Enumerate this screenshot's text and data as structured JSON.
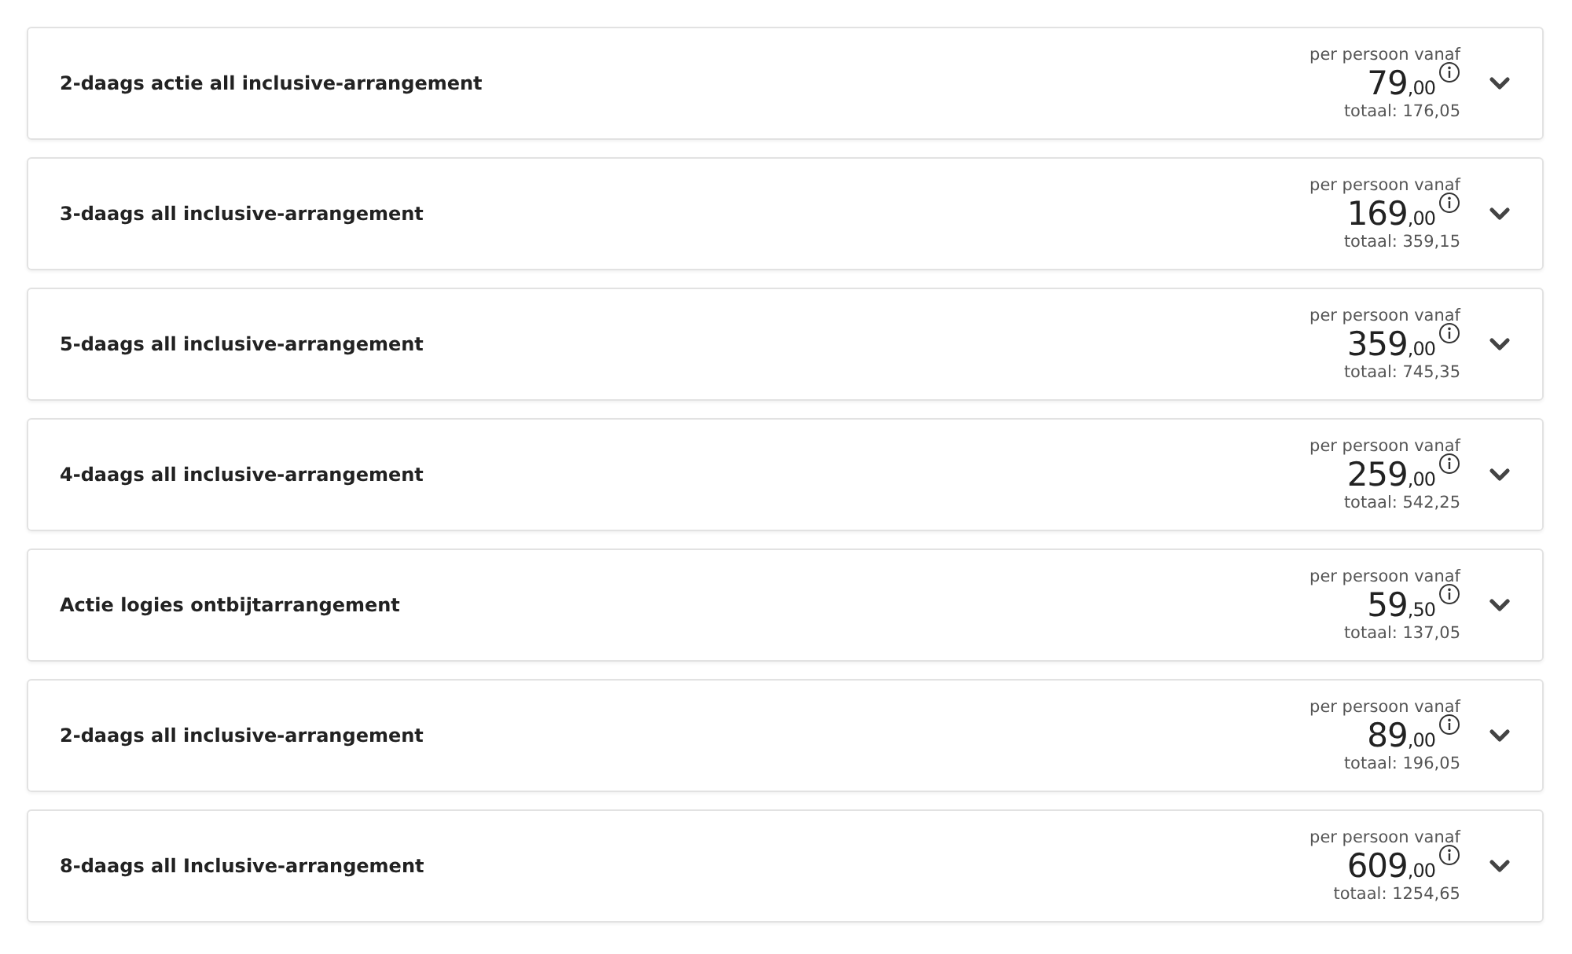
{
  "offers": [
    {
      "title": "2-daags actie all inclusive-arrangement",
      "per_label": "per persoon vanaf",
      "price_whole": "79",
      "price_cents": ",00",
      "total": "totaal: 176,05",
      "expanded": false
    },
    {
      "title": "3-daags all inclusive-arrangement",
      "per_label": "per persoon vanaf",
      "price_whole": "169",
      "price_cents": ",00",
      "total": "totaal: 359,15",
      "expanded": false
    },
    {
      "title": "5-daags all inclusive-arrangement",
      "per_label": "per persoon vanaf",
      "price_whole": "359",
      "price_cents": ",00",
      "total": "totaal: 745,35",
      "expanded": false
    },
    {
      "title": "4-daags all inclusive-arrangement",
      "per_label": "per persoon vanaf",
      "price_whole": "259",
      "price_cents": ",00",
      "total": "totaal: 542,25",
      "expanded": false
    },
    {
      "title": "Actie logies ontbijtarrangement",
      "per_label": "per persoon vanaf",
      "price_whole": "59",
      "price_cents": ",50",
      "total": "totaal: 137,05",
      "expanded": false
    },
    {
      "title": "2-daags all inclusive-arrangement",
      "per_label": "per persoon vanaf",
      "price_whole": "89",
      "price_cents": ",00",
      "total": "totaal: 196,05",
      "expanded": false
    },
    {
      "title": "8-daags all Inclusive-arrangement",
      "per_label": "per persoon vanaf",
      "price_whole": "609",
      "price_cents": ",00",
      "total": "totaal: 1254,65",
      "expanded": false
    }
  ]
}
